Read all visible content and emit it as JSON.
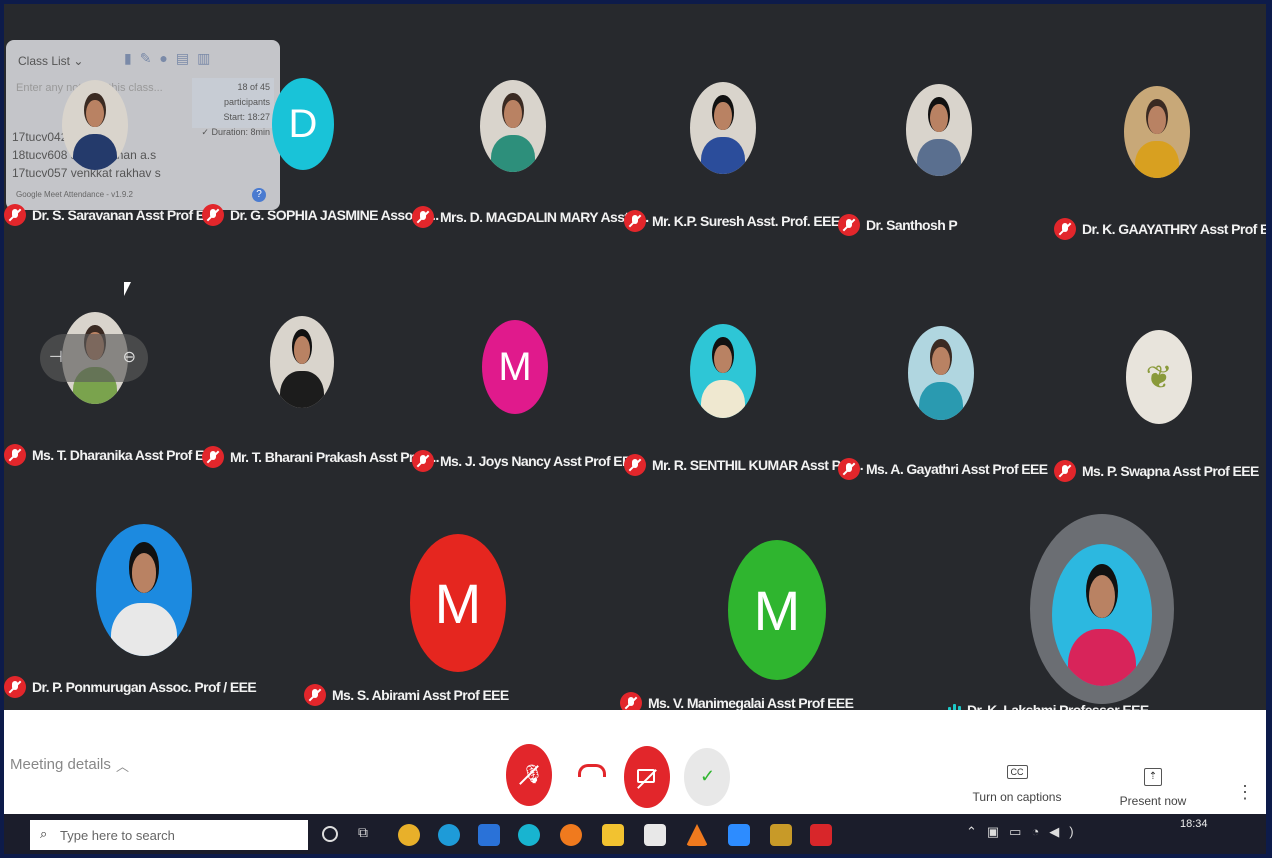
{
  "overlay": {
    "title": "Class List ⌄",
    "participants": "18 of 45 participants",
    "start": "Start: 18:27",
    "duration": "✓ Duration: 8min",
    "hint": "Enter any notes to this class...",
    "rows": [
      "17tucv042",
      "18tucv608 su.. darshan a.s",
      "17tucv057 venkkat rakhav s"
    ],
    "footer": "Google Meet Attendance - v1.9.2"
  },
  "participants": [
    {
      "name": "Dr. S. Saravanan Asst Prof EEE",
      "type": "photo",
      "muted": true
    },
    {
      "name": "Dr. G. SOPHIA JASMINE Asso Pr...",
      "type": "letter",
      "letter": "D",
      "color": "#19c3d8",
      "muted": true
    },
    {
      "name": "Mrs. D. MAGDALIN MARY Asst P...",
      "type": "photo",
      "muted": true
    },
    {
      "name": "Mr. K.P. Suresh Asst. Prof. EEE",
      "type": "photo",
      "muted": true
    },
    {
      "name": "Dr. Santhosh P",
      "type": "photo",
      "muted": true
    },
    {
      "name": "Dr. K. GAAYATHRY Asst Prof EEE",
      "type": "photo",
      "muted": true
    },
    {
      "name": "Ms. T. Dharanika Asst Prof EEE",
      "type": "photo",
      "muted": true
    },
    {
      "name": "Mr. T. Bharani Prakash Asst Prof ...",
      "type": "photo",
      "muted": true
    },
    {
      "name": "Ms. J. Joys Nancy Asst Prof EEE",
      "type": "letter",
      "letter": "M",
      "color": "#e01a8c",
      "muted": true
    },
    {
      "name": "Mr. R. SENTHIL KUMAR Asst Pro...",
      "type": "photo",
      "muted": true
    },
    {
      "name": "Ms. A. Gayathri Asst Prof EEE",
      "type": "photo",
      "muted": true
    },
    {
      "name": "Ms. P. Swapna Asst Prof EEE",
      "type": "photo",
      "muted": true
    },
    {
      "name": "Dr. P. Ponmurugan Assoc. Prof / EEE",
      "type": "photo",
      "muted": true
    },
    {
      "name": "Ms. S. Abirami Asst Prof EEE",
      "type": "letter",
      "letter": "M",
      "color": "#e5261f",
      "muted": true
    },
    {
      "name": "Ms. V. Manimegalai Asst Prof EEE",
      "type": "letter",
      "letter": "M",
      "color": "#2fb52f",
      "muted": true
    },
    {
      "name": "Dr. K. Lakshmi Professor EEE",
      "type": "photo",
      "muted": false,
      "speaking": true
    }
  ],
  "bottom": {
    "meeting_details": "Meeting details",
    "captions": "Turn on captions",
    "captions_icon": "CC",
    "present": "Present now"
  },
  "taskbar": {
    "search_placeholder": "Type here to search",
    "time": "18:34"
  },
  "colors": {
    "mic_off": "#e2262b",
    "bg": "#27292d",
    "accent": "#1ec8c8"
  }
}
